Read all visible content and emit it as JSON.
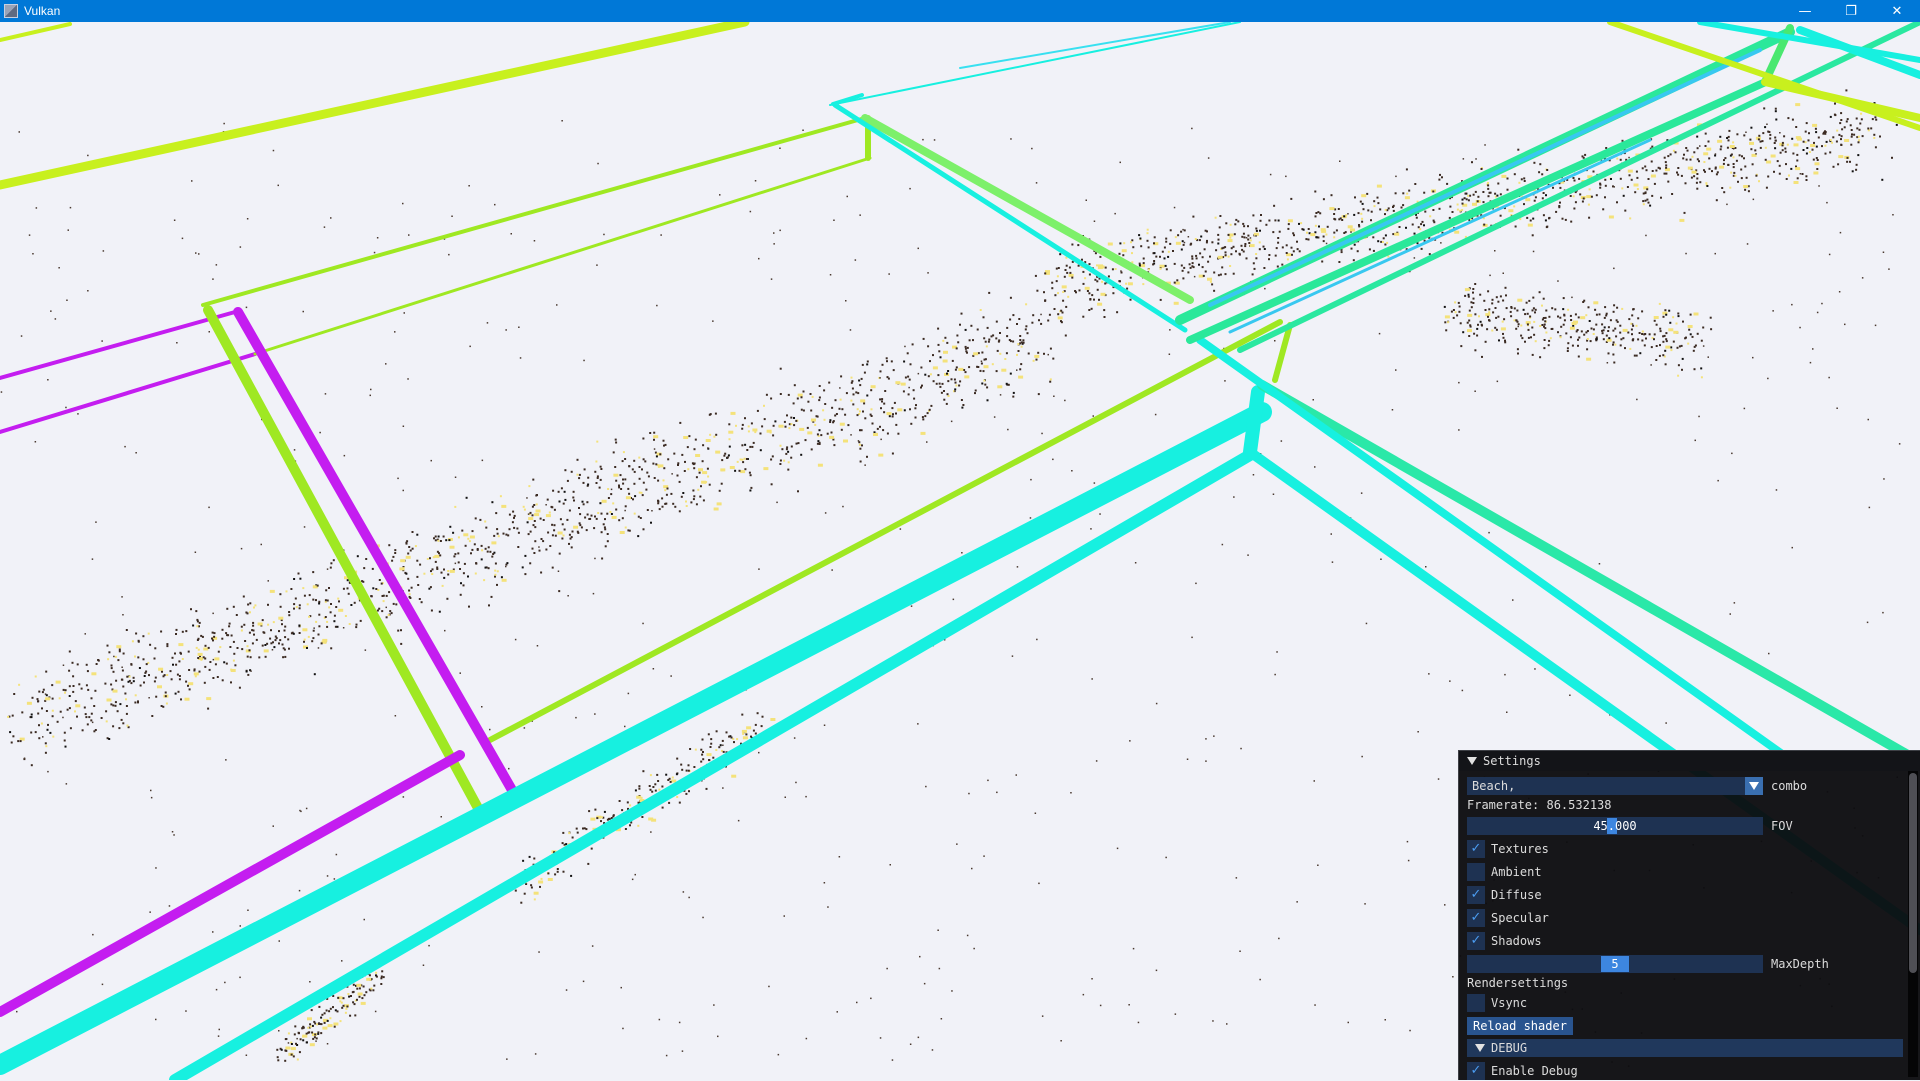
{
  "window": {
    "title": "Vulkan",
    "icons": [
      "app-icon",
      "minimize-icon",
      "restore-icon",
      "close-icon"
    ]
  },
  "colors": {
    "titlebar": "#0078d7",
    "background": "#f1f2f8",
    "lime": "#9fe822",
    "yellow_green": "#c8f01e",
    "green": "#2ae89a",
    "cyan": "#17f0e0",
    "magenta": "#c41df0",
    "sky": "#38c8f0",
    "panel_bg": "#0c0d10",
    "accent": "#3d86e0"
  },
  "settings": {
    "header": "Settings",
    "scene_combo": {
      "value": "Beach,",
      "label": "combo"
    },
    "framerate": "Framerate: 86.532138",
    "fov": {
      "value": "45.000",
      "label": "FOV",
      "fraction": 0.49
    },
    "checkboxes": [
      {
        "label": "Textures",
        "checked": true
      },
      {
        "label": "Ambient",
        "checked": false
      },
      {
        "label": "Diffuse",
        "checked": true
      },
      {
        "label": "Specular",
        "checked": true
      },
      {
        "label": "Shadows",
        "checked": true
      }
    ],
    "maxdepth": {
      "value": "5",
      "label": "MaxDepth",
      "fraction": 0.5
    },
    "rendersettings_label": "Rendersettings",
    "vsync": {
      "label": "Vsync",
      "checked": false
    },
    "reload_button": "Reload shader",
    "debug_header": "DEBUG",
    "enable_debug": {
      "label": "Enable Debug",
      "checked": true
    }
  }
}
